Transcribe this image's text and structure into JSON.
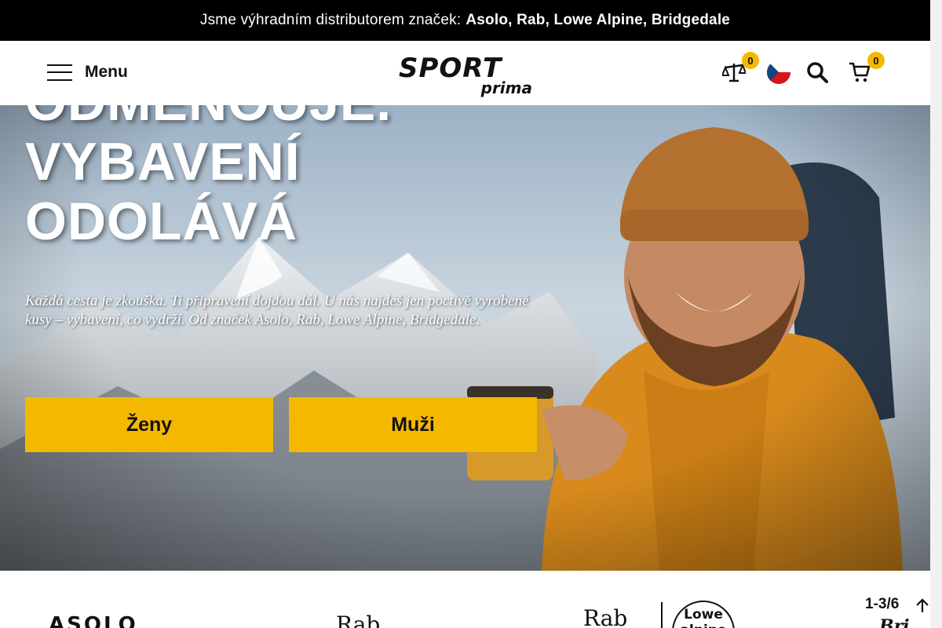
{
  "announcement": {
    "text": "Jsme výhradním distributorem značek:",
    "brands": "Asolo, Rab, Lowe Alpine, Bridgedale"
  },
  "header": {
    "menu_label": "Menu",
    "logo_top": "SPORT",
    "logo_bottom": "prima",
    "compare_count": "0",
    "cart_count": "0",
    "icons": [
      "hamburger-icon",
      "scale-icon",
      "czech-flag-icon",
      "search-icon",
      "cart-icon"
    ]
  },
  "hero": {
    "headline_line1": "ODMĚNOUJE.",
    "headline_line2": "VYBAVENÍ",
    "headline_line3": "ODOLÁVÁ",
    "subtext": "Každá cesta je zkouška. Ti připravení dojdou dál. U nás najdeš jen poctivě vyrobené kusy – vybavení, co vydrží. Od značek Asolo, Rab, Lowe Alpine, Bridgedale.",
    "women_button": "Ženy",
    "men_button": "Muži"
  },
  "brands": {
    "items": [
      "ASOLO",
      "Rab",
      "Rab",
      "Lowe alpine",
      "Bri"
    ],
    "pager": "1-3/6"
  },
  "colors": {
    "accent": "#f5b800",
    "topbar": "#000000"
  }
}
